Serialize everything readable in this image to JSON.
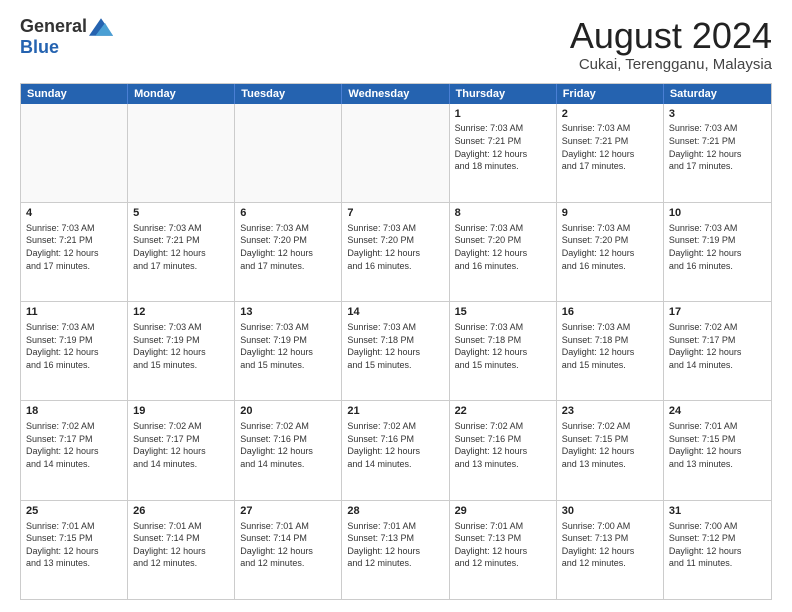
{
  "logo": {
    "general": "General",
    "blue": "Blue"
  },
  "title": "August 2024",
  "subtitle": "Cukai, Terengganu, Malaysia",
  "header_days": [
    "Sunday",
    "Monday",
    "Tuesday",
    "Wednesday",
    "Thursday",
    "Friday",
    "Saturday"
  ],
  "weeks": [
    [
      {
        "day": "",
        "info": "",
        "empty": true
      },
      {
        "day": "",
        "info": "",
        "empty": true
      },
      {
        "day": "",
        "info": "",
        "empty": true
      },
      {
        "day": "",
        "info": "",
        "empty": true
      },
      {
        "day": "1",
        "info": "Sunrise: 7:03 AM\nSunset: 7:21 PM\nDaylight: 12 hours\nand 18 minutes.",
        "empty": false
      },
      {
        "day": "2",
        "info": "Sunrise: 7:03 AM\nSunset: 7:21 PM\nDaylight: 12 hours\nand 17 minutes.",
        "empty": false
      },
      {
        "day": "3",
        "info": "Sunrise: 7:03 AM\nSunset: 7:21 PM\nDaylight: 12 hours\nand 17 minutes.",
        "empty": false
      }
    ],
    [
      {
        "day": "4",
        "info": "Sunrise: 7:03 AM\nSunset: 7:21 PM\nDaylight: 12 hours\nand 17 minutes.",
        "empty": false
      },
      {
        "day": "5",
        "info": "Sunrise: 7:03 AM\nSunset: 7:21 PM\nDaylight: 12 hours\nand 17 minutes.",
        "empty": false
      },
      {
        "day": "6",
        "info": "Sunrise: 7:03 AM\nSunset: 7:20 PM\nDaylight: 12 hours\nand 17 minutes.",
        "empty": false
      },
      {
        "day": "7",
        "info": "Sunrise: 7:03 AM\nSunset: 7:20 PM\nDaylight: 12 hours\nand 16 minutes.",
        "empty": false
      },
      {
        "day": "8",
        "info": "Sunrise: 7:03 AM\nSunset: 7:20 PM\nDaylight: 12 hours\nand 16 minutes.",
        "empty": false
      },
      {
        "day": "9",
        "info": "Sunrise: 7:03 AM\nSunset: 7:20 PM\nDaylight: 12 hours\nand 16 minutes.",
        "empty": false
      },
      {
        "day": "10",
        "info": "Sunrise: 7:03 AM\nSunset: 7:19 PM\nDaylight: 12 hours\nand 16 minutes.",
        "empty": false
      }
    ],
    [
      {
        "day": "11",
        "info": "Sunrise: 7:03 AM\nSunset: 7:19 PM\nDaylight: 12 hours\nand 16 minutes.",
        "empty": false
      },
      {
        "day": "12",
        "info": "Sunrise: 7:03 AM\nSunset: 7:19 PM\nDaylight: 12 hours\nand 15 minutes.",
        "empty": false
      },
      {
        "day": "13",
        "info": "Sunrise: 7:03 AM\nSunset: 7:19 PM\nDaylight: 12 hours\nand 15 minutes.",
        "empty": false
      },
      {
        "day": "14",
        "info": "Sunrise: 7:03 AM\nSunset: 7:18 PM\nDaylight: 12 hours\nand 15 minutes.",
        "empty": false
      },
      {
        "day": "15",
        "info": "Sunrise: 7:03 AM\nSunset: 7:18 PM\nDaylight: 12 hours\nand 15 minutes.",
        "empty": false
      },
      {
        "day": "16",
        "info": "Sunrise: 7:03 AM\nSunset: 7:18 PM\nDaylight: 12 hours\nand 15 minutes.",
        "empty": false
      },
      {
        "day": "17",
        "info": "Sunrise: 7:02 AM\nSunset: 7:17 PM\nDaylight: 12 hours\nand 14 minutes.",
        "empty": false
      }
    ],
    [
      {
        "day": "18",
        "info": "Sunrise: 7:02 AM\nSunset: 7:17 PM\nDaylight: 12 hours\nand 14 minutes.",
        "empty": false
      },
      {
        "day": "19",
        "info": "Sunrise: 7:02 AM\nSunset: 7:17 PM\nDaylight: 12 hours\nand 14 minutes.",
        "empty": false
      },
      {
        "day": "20",
        "info": "Sunrise: 7:02 AM\nSunset: 7:16 PM\nDaylight: 12 hours\nand 14 minutes.",
        "empty": false
      },
      {
        "day": "21",
        "info": "Sunrise: 7:02 AM\nSunset: 7:16 PM\nDaylight: 12 hours\nand 14 minutes.",
        "empty": false
      },
      {
        "day": "22",
        "info": "Sunrise: 7:02 AM\nSunset: 7:16 PM\nDaylight: 12 hours\nand 13 minutes.",
        "empty": false
      },
      {
        "day": "23",
        "info": "Sunrise: 7:02 AM\nSunset: 7:15 PM\nDaylight: 12 hours\nand 13 minutes.",
        "empty": false
      },
      {
        "day": "24",
        "info": "Sunrise: 7:01 AM\nSunset: 7:15 PM\nDaylight: 12 hours\nand 13 minutes.",
        "empty": false
      }
    ],
    [
      {
        "day": "25",
        "info": "Sunrise: 7:01 AM\nSunset: 7:15 PM\nDaylight: 12 hours\nand 13 minutes.",
        "empty": false
      },
      {
        "day": "26",
        "info": "Sunrise: 7:01 AM\nSunset: 7:14 PM\nDaylight: 12 hours\nand 12 minutes.",
        "empty": false
      },
      {
        "day": "27",
        "info": "Sunrise: 7:01 AM\nSunset: 7:14 PM\nDaylight: 12 hours\nand 12 minutes.",
        "empty": false
      },
      {
        "day": "28",
        "info": "Sunrise: 7:01 AM\nSunset: 7:13 PM\nDaylight: 12 hours\nand 12 minutes.",
        "empty": false
      },
      {
        "day": "29",
        "info": "Sunrise: 7:01 AM\nSunset: 7:13 PM\nDaylight: 12 hours\nand 12 minutes.",
        "empty": false
      },
      {
        "day": "30",
        "info": "Sunrise: 7:00 AM\nSunset: 7:13 PM\nDaylight: 12 hours\nand 12 minutes.",
        "empty": false
      },
      {
        "day": "31",
        "info": "Sunrise: 7:00 AM\nSunset: 7:12 PM\nDaylight: 12 hours\nand 11 minutes.",
        "empty": false
      }
    ]
  ]
}
